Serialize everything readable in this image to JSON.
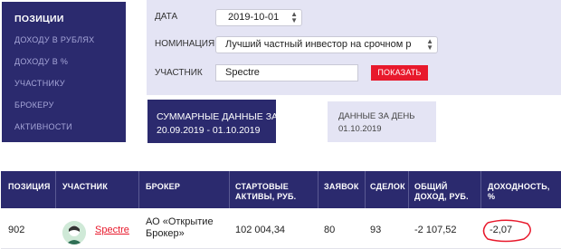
{
  "nav": {
    "items": [
      {
        "label": "ПОЗИЦИИ",
        "active": true
      },
      {
        "label": "ДОХОДУ В РУБЛЯХ"
      },
      {
        "label": "ДОХОДУ В %"
      },
      {
        "label": "УЧАСТНИКУ"
      },
      {
        "label": "БРОКЕРУ"
      },
      {
        "label": "АКТИВНОСТИ"
      }
    ]
  },
  "filter": {
    "date_label": "ДАТА",
    "date_value": "2019-10-01",
    "nomination_label": "НОМИНАЦИЯ",
    "nomination_value": "Лучший частный инвестор на срочном р",
    "participant_label": "УЧАСТНИК",
    "participant_value": "Spectre",
    "show_button": "ПОКАЗАТЬ"
  },
  "tabs": {
    "summary_title": "СУММАРНЫЕ ДАННЫЕ ЗА",
    "summary_period": "20.09.2019 - 01.10.2019",
    "day_title": "ДАННЫЕ ЗА ДЕНЬ",
    "day_date": "01.10.2019"
  },
  "table": {
    "headers": [
      "ПОЗИЦИЯ",
      "УЧАСТНИК",
      "БРОКЕР",
      "СТАРТОВЫЕ АКТИВЫ, РУБ.",
      "ЗАЯВОК",
      "СДЕЛОК",
      "ОБЩИЙ ДОХОД, РУБ.",
      "ДОХОДНОСТЬ, %"
    ],
    "rows": [
      {
        "position": "902",
        "participant": "Spectre",
        "broker": "АО «Открытие Брокер»",
        "start_assets": "102 004,34",
        "orders": "80",
        "deals": "93",
        "total_income": "-2 107,52",
        "yield": "-2,07"
      }
    ]
  },
  "colors": {
    "navy": "#2b2a6e",
    "panel": "#e4e4f4",
    "accent_red": "#e8192c"
  },
  "icons": [
    "chevron-updown-icon",
    "avatar-icon"
  ]
}
